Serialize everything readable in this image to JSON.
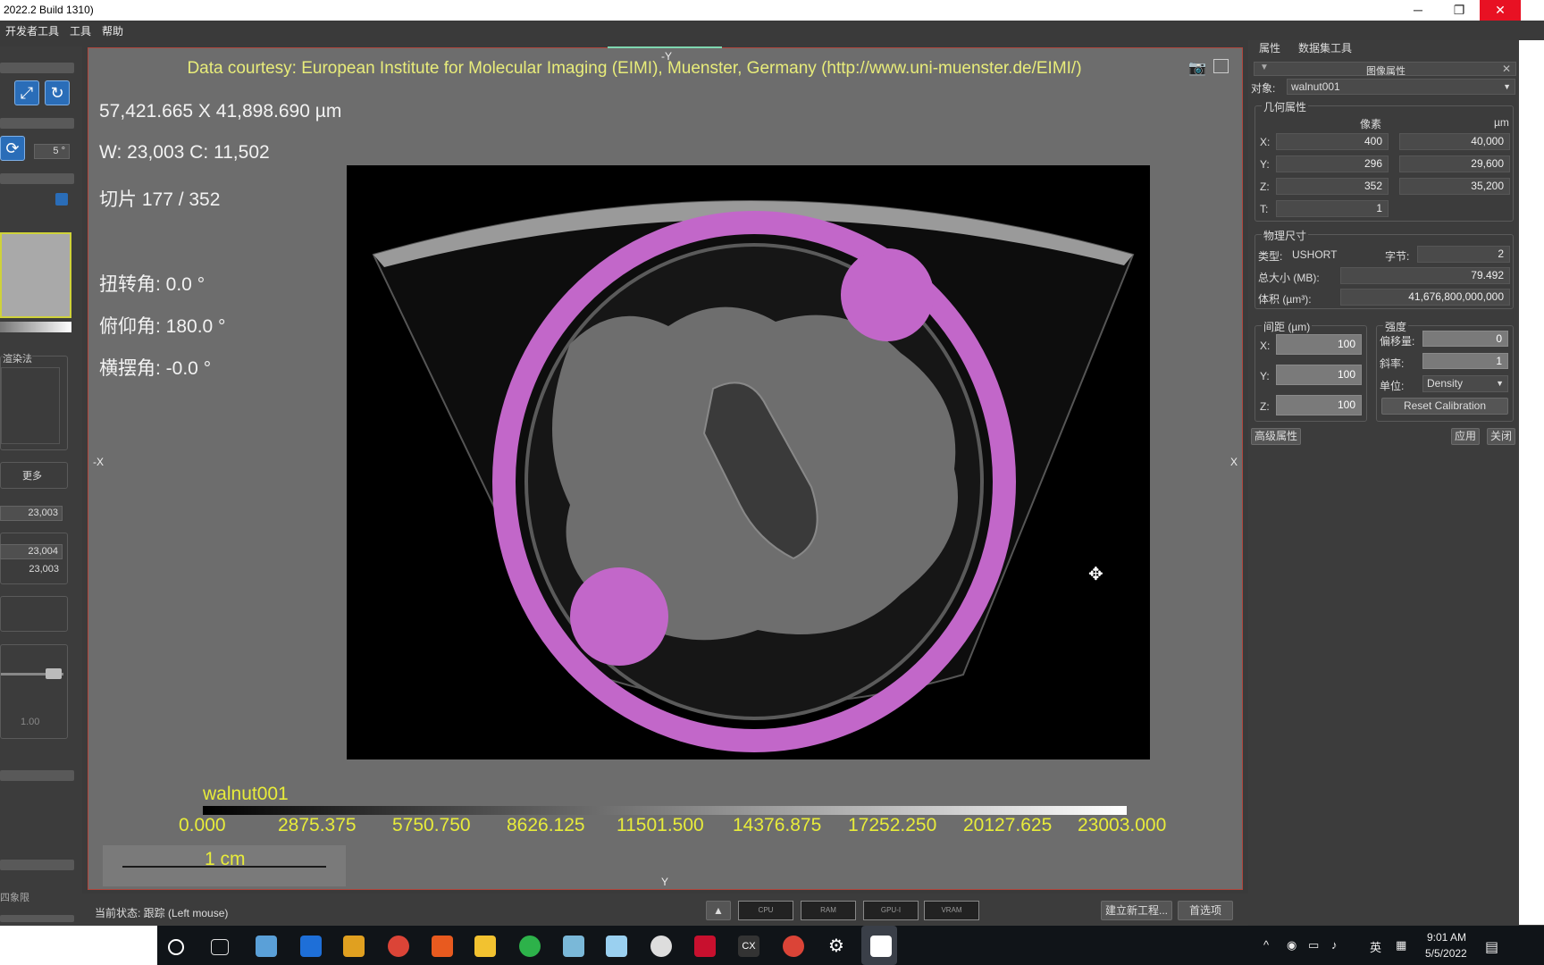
{
  "window": {
    "title": "2022.2 Build 1310)",
    "minimize": "─",
    "maximize": "❐",
    "close": "✕"
  },
  "menu": [
    "开发者工具",
    "工具",
    "帮助"
  ],
  "left_panel": {
    "rotate_step": "5 °",
    "group_label": "渲染法",
    "more": "更多",
    "field1": "23,003",
    "field2": "23,004",
    "field3": "23,003",
    "small_value": "1.00",
    "bottom_label": "四象限"
  },
  "viewer": {
    "courtesy": "Data courtesy: European Institute for Molecular Imaging (EIMI), Muenster, Germany (http://www.uni-muenster.de/EIMI/)",
    "dimensions": "57,421.665 X 41,898.690 µm",
    "window_level": "W: 23,003 C: 11,502",
    "slice": "切片 177 / 352",
    "twist": "扭转角: 0.0 °",
    "pitch": "俯仰角: 180.0 °",
    "yaw": "横摆角: -0.0 °",
    "axis_top": "-Y",
    "axis_bottom": "Y",
    "axis_left": "-X",
    "axis_right": "X",
    "colorbar_name": "walnut001",
    "ticks": [
      "0.000",
      "2875.375",
      "5750.750",
      "8626.125",
      "11501.500",
      "14376.875",
      "17252.250",
      "20127.625",
      "23003.000"
    ],
    "scale_label": "1 cm"
  },
  "status": {
    "text": "当前状态: 跟踪 (Left mouse)",
    "meters": [
      "CPU",
      "RAM",
      "GPU-I",
      "VRAM"
    ],
    "new_project": "建立新工程...",
    "preferences": "首选项"
  },
  "right_panel": {
    "tabs": [
      "属性",
      "数据集工具"
    ],
    "header": "图像属性",
    "object_label": "对象:",
    "object_value": "walnut001",
    "geometry": {
      "title": "几何属性",
      "col_pixel": "像素",
      "col_um": "µm",
      "rows": [
        {
          "label": "X:",
          "pixel": "400",
          "um": "40,000"
        },
        {
          "label": "Y:",
          "pixel": "296",
          "um": "29,600"
        },
        {
          "label": "Z:",
          "pixel": "352",
          "um": "35,200"
        },
        {
          "label": "T:",
          "pixel": "1",
          "um": ""
        }
      ]
    },
    "physical": {
      "title": "物理尺寸",
      "type_label": "类型:",
      "type_value": "USHORT",
      "bytes_label": "字节:",
      "bytes_value": "2",
      "size_label": "总大小 (MB):",
      "size_value": "79.492",
      "volume_label": "体积 (µm³):",
      "volume_value": "41,676,800,000,000"
    },
    "spacing": {
      "title": "间距 (µm)",
      "rows": [
        {
          "label": "X:",
          "value": "100"
        },
        {
          "label": "Y:",
          "value": "100"
        },
        {
          "label": "Z:",
          "value": "100"
        }
      ]
    },
    "intensity": {
      "title": "强度",
      "offset_label": "偏移量:",
      "offset_value": "0",
      "slope_label": "斜率:",
      "slope_value": "1",
      "unit_label": "单位:",
      "unit_value": "Density",
      "reset": "Reset Calibration"
    },
    "advanced": "高级属性",
    "apply": "应用",
    "close": "关闭"
  },
  "taskbar": {
    "ime": "英",
    "time": "9:01 AM",
    "date": "5/5/2022"
  }
}
